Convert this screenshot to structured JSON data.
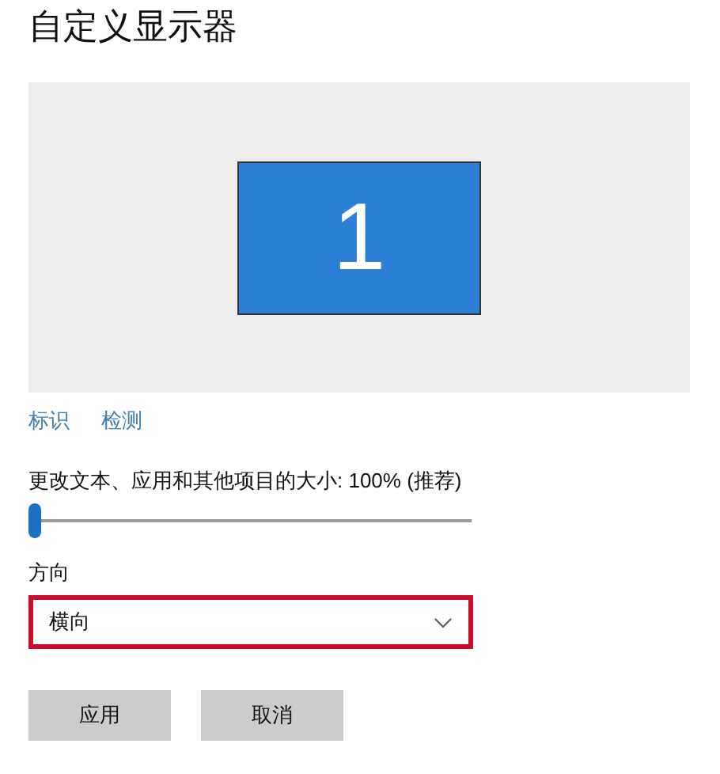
{
  "title": "自定义显示器",
  "display": {
    "number": "1"
  },
  "links": [
    "标识",
    "检测"
  ],
  "scale": {
    "label": "更改文本、应用和其他项目的大小: 100% (推荐)",
    "level": 0
  },
  "orientation": {
    "label": "方向",
    "value": "横向",
    "highlighted": true
  },
  "buttons": [
    "应用",
    "取消"
  ]
}
